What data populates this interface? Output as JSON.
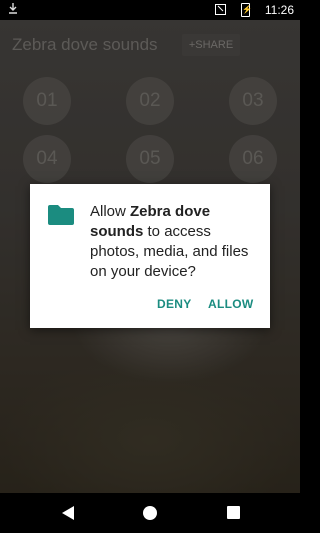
{
  "status_bar": {
    "time": "11:26",
    "battery_glyph": "⚡"
  },
  "app": {
    "title": "Zebra dove sounds",
    "share_label": "+SHARE",
    "sound_buttons": [
      "01",
      "02",
      "03",
      "04",
      "05",
      "06"
    ]
  },
  "dialog": {
    "msg_prefix": "Allow ",
    "app_name": "Zebra dove sounds",
    "msg_suffix": " to access photos, media, and files on your device?",
    "deny_label": "DENY",
    "allow_label": "ALLOW",
    "accent_color": "#1b8c80"
  },
  "nav": {
    "icons": [
      "back-icon",
      "home-icon",
      "recents-icon"
    ]
  }
}
